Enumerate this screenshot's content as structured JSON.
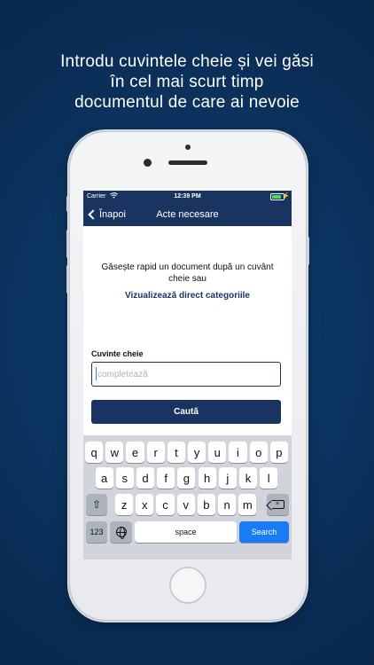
{
  "headline": {
    "line1": "Introdu cuvintele cheie și vei găsi",
    "line2": "în cel mai scurt timp",
    "line3": "documentul de care ai nevoie"
  },
  "status_bar": {
    "carrier": "Carrier",
    "time": "12:39 PM",
    "battery_level": 0.85
  },
  "nav": {
    "back_label": "Înapoi",
    "title": "Acte necesare"
  },
  "content": {
    "intro": "Găsește rapid un document după un cuvânt cheie sau",
    "categories_link": "Vizualizează direct categoriile",
    "keyword_label": "Cuvinte cheie",
    "keyword_placeholder": "completează",
    "keyword_value": "",
    "search_button": "Caută"
  },
  "keyboard": {
    "row1": [
      "q",
      "w",
      "e",
      "r",
      "t",
      "y",
      "u",
      "i",
      "o",
      "p"
    ],
    "row2": [
      "a",
      "s",
      "d",
      "f",
      "g",
      "h",
      "j",
      "k",
      "l"
    ],
    "row3": [
      "z",
      "x",
      "c",
      "v",
      "b",
      "n",
      "m"
    ],
    "numbers_key": "123",
    "space_key": "space",
    "search_key": "Search"
  },
  "colors": {
    "brand_navy": "#1a3462",
    "keyboard_bg": "#d1d5db",
    "search_key_blue": "#1a7cf5"
  }
}
